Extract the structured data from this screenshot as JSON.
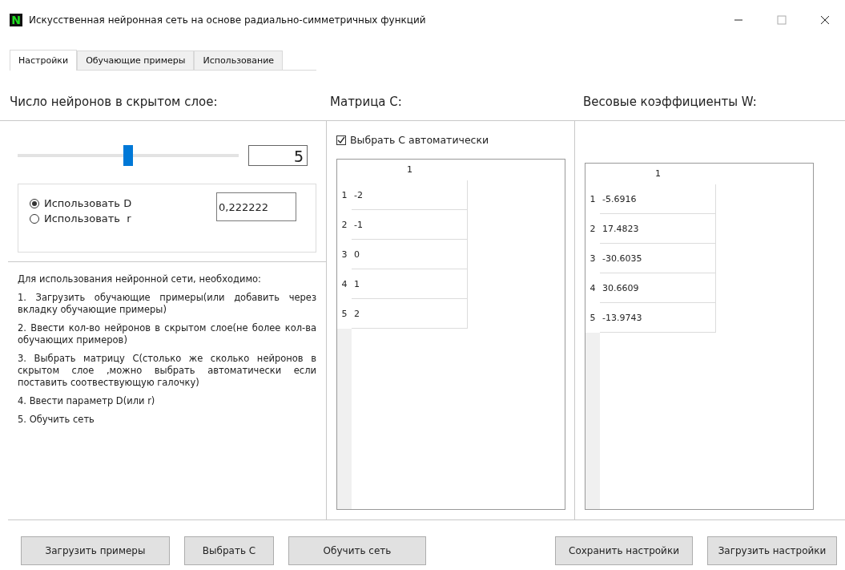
{
  "window": {
    "logo": "N",
    "title": "Искусственная нейронная сеть на основе радиально-симметричных функций"
  },
  "tabs": [
    {
      "label": "Настройки",
      "selected": true
    },
    {
      "label": "Обучающие примеры",
      "selected": false
    },
    {
      "label": "Использование",
      "selected": false
    }
  ],
  "neurons": {
    "heading": "Число нейронов в скрытом слое:",
    "slider": {
      "level": 0.5
    },
    "display": "5"
  },
  "parameter": {
    "options": [
      {
        "label": "Использовать D",
        "selected": true
      },
      {
        "label": "Использовать  r",
        "selected": false
      }
    ],
    "value": "0,222222"
  },
  "instructions": [
    "Для использования нейронной сети, необходимо:",
    "1. Загрузить обучающие примеры(или добавить через вкладку обучающие примеры)",
    "2. Ввести кол-во нейронов в скрытом слое(не более кол-ва обучающих примеров)",
    "3. Выбрать матрицу С(столько же сколько нейронов в скрытом слое ,можно выбрать автоматически если поставить соотвествующую галочку)",
    "4. Ввести параметр D(или r)",
    "5. Обучить сеть"
  ],
  "matrix_c": {
    "heading": "Матрица С:",
    "auto": {
      "label": "Выбрать С автоматически",
      "checked": true
    },
    "column": "1",
    "rows": [
      {
        "index": "1",
        "value": "-2"
      },
      {
        "index": "2",
        "value": "-1"
      },
      {
        "index": "3",
        "value": "0"
      },
      {
        "index": "4",
        "value": "1"
      },
      {
        "index": "5",
        "value": "2"
      }
    ]
  },
  "weights": {
    "heading": "Весовые коэффициенты W:",
    "column": "1",
    "rows": [
      {
        "index": "1",
        "value": "-5.6916"
      },
      {
        "index": "2",
        "value": "17.4823"
      },
      {
        "index": "3",
        "value": "-30.6035"
      },
      {
        "index": "4",
        "value": "30.6609"
      },
      {
        "index": "5",
        "value": "-13.9743"
      }
    ]
  },
  "buttons_left": [
    "Загрузить примеры",
    "Выбрать С",
    "Обучить сеть"
  ],
  "buttons_right": [
    "Сохранить настройки",
    "Загрузить настройки"
  ]
}
